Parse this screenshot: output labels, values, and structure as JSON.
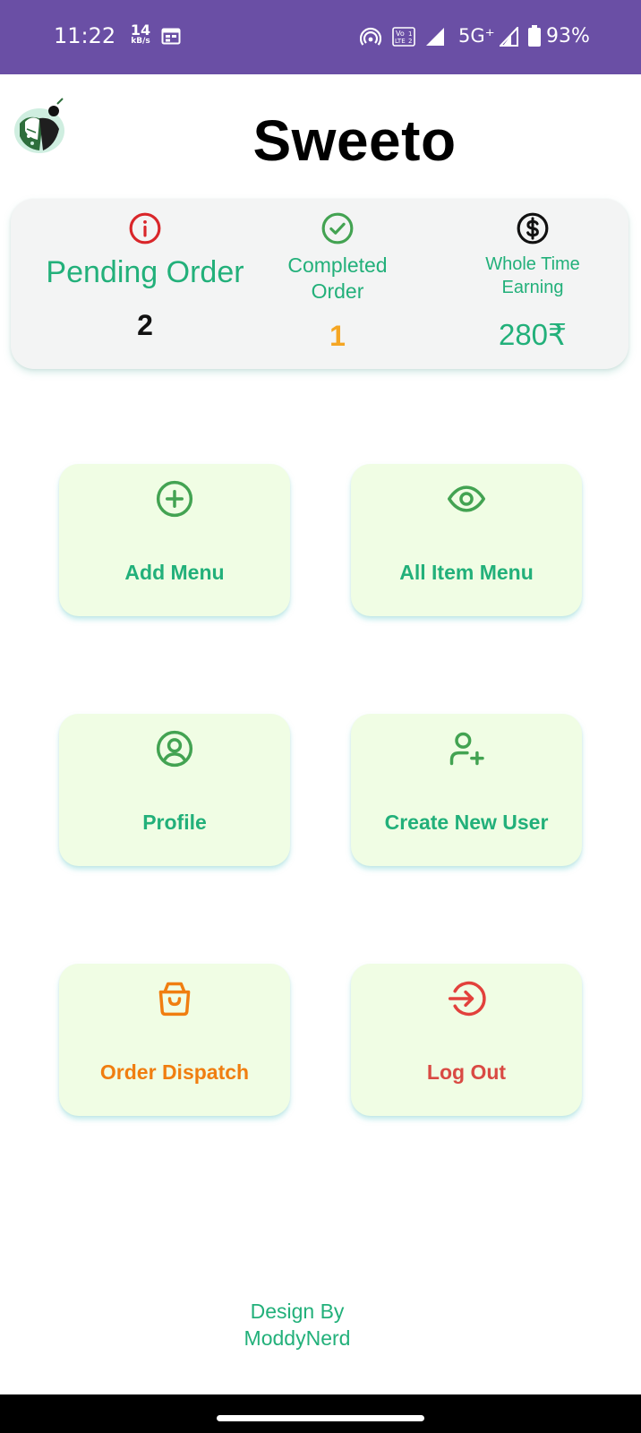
{
  "status_bar": {
    "time": "11:22",
    "net_speed_value": "14",
    "net_speed_unit": "kB/s",
    "network_type": "5G⁺",
    "battery": "93%"
  },
  "header": {
    "title": "Sweeto"
  },
  "stats": {
    "pending": {
      "label": "Pending Order",
      "value": "2"
    },
    "completed": {
      "label_line1": "Completed",
      "label_line2": "Order",
      "value": "1"
    },
    "earning": {
      "label_line1": "Whole Time",
      "label_line2": "Earning",
      "value": "280₹"
    }
  },
  "menu": {
    "add_menu": "Add Menu",
    "all_item_menu": "All Item Menu",
    "profile": "Profile",
    "create_new_user": "Create New User",
    "order_dispatch": "Order Dispatch",
    "log_out": "Log Out"
  },
  "footer": {
    "line1": "Design By",
    "line2": "ModdyNerd"
  },
  "colors": {
    "status_bar": "#6a4fa5",
    "accent_green": "#22b07a",
    "icon_green": "#43a352",
    "tile_bg": "#f0fde4",
    "completed_value": "#f5a623",
    "dispatch_orange": "#f07e10",
    "logout_red": "#d94a43",
    "pending_icon_red": "#d9262a"
  },
  "icons": {
    "pending": "info-circle-icon",
    "completed": "check-circle-icon",
    "earning": "dollar-circle-icon",
    "add_menu": "plus-circle-icon",
    "all_item_menu": "eye-icon",
    "profile": "user-circle-icon",
    "create_new_user": "user-plus-icon",
    "order_dispatch": "shopping-bag-icon",
    "log_out": "logout-icon"
  }
}
